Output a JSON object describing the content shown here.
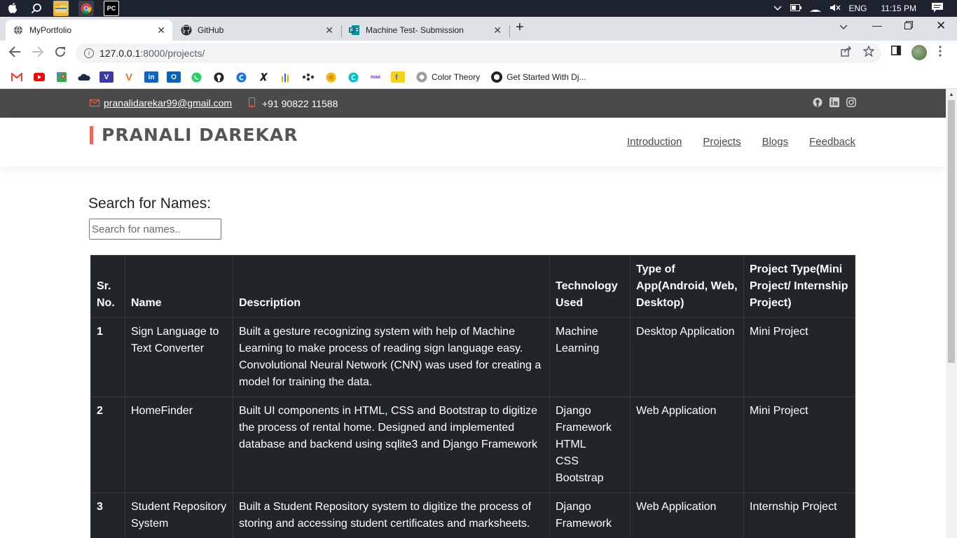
{
  "os": {
    "language": "ENG",
    "time": "11:15 PM"
  },
  "browser": {
    "tabs": [
      {
        "title": "MyPortfolio"
      },
      {
        "title": "GitHub"
      },
      {
        "title": "Machine Test- Submission"
      }
    ],
    "url_host": "127.0.0.1",
    "url_rest": ":8000/projects/",
    "bookmarks": [
      {
        "label": "Color Theory"
      },
      {
        "label": "Get Started With Dj..."
      }
    ]
  },
  "site": {
    "email": "pranalidarekar99@gmail.com",
    "phone": "+91 90822 11588",
    "brand": "PRANALI DAREKAR",
    "nav": [
      {
        "label": "Introduction"
      },
      {
        "label": "Projects"
      },
      {
        "label": "Blogs"
      },
      {
        "label": "Feedback"
      }
    ]
  },
  "search": {
    "label": "Search for Names:",
    "placeholder": "Search for names.."
  },
  "table": {
    "headers": [
      "Sr. No.",
      "Name",
      "Description",
      "Technology Used",
      "Type of App(Android, Web, Desktop)",
      "Project Type(Mini Project/ Internship Project)"
    ],
    "rows": [
      {
        "num": "1",
        "name": "Sign Language to Text Converter",
        "description": "Built a gesture recognizing system with help of Machine Learning to make process of reading sign language easy. Convolutional Neural Network (CNN) was used for creating a model for training the data.",
        "tech": [
          "Machine Learning"
        ],
        "app_type": "Desktop Application",
        "project_type": "Mini Project"
      },
      {
        "num": "2",
        "name": "HomeFinder",
        "description": "Built UI components in HTML, CSS and Bootstrap to digitize the process of rental home. Designed and implemented database and backend using sqlite3 and Django Framework",
        "tech": [
          "Django Framework",
          "HTML",
          "CSS",
          "Bootstrap"
        ],
        "app_type": "Web Application",
        "project_type": "Mini Project"
      },
      {
        "num": "3",
        "name": "Student Repository System",
        "description": "Built a Student Repository system to digitize the process of storing and accessing student certificates and marksheets.",
        "tech": [
          "Django Framework"
        ],
        "app_type": "Web Application",
        "project_type": "Internship Project"
      }
    ]
  }
}
